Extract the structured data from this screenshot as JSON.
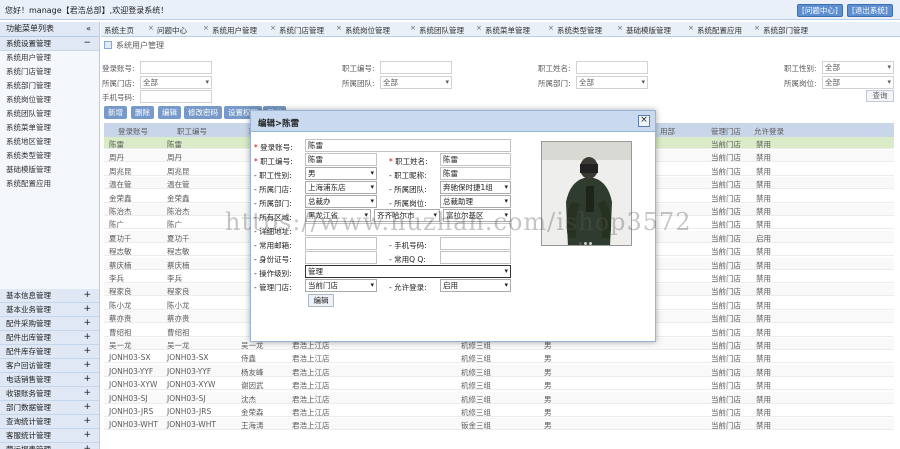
{
  "header": {
    "welcome": "您好！manage【君浩总部】,欢迎登录系统！",
    "help_button": "[问题中心]",
    "logout_button": "[退出系统]"
  },
  "sidebar": {
    "title": "功能菜单列表",
    "title_toggle": "«",
    "open_group": "系统设置管理",
    "open_group_toggle": "−",
    "items": [
      "系统用户管理",
      "系统门店管理",
      "系统部门管理",
      "系统岗位管理",
      "系统团队管理",
      "系统菜单管理",
      "系统地区管理",
      "系统类型管理",
      "基础模版管理",
      "系统配置应用"
    ],
    "groups": [
      "基本信息管理",
      "基本业务管理",
      "配件采购管理",
      "配件出库管理",
      "配件库存管理",
      "客户回访管理",
      "电话销售管理",
      "收银账务管理",
      "部门数据管理",
      "查询统计管理",
      "客服统计管理",
      "营运报表管理",
      "配件报价中心"
    ],
    "group_toggle": "+"
  },
  "tabs": [
    "系统主页",
    "问题中心",
    "系统用户管理",
    "系统门店管理",
    "系统岗位管理",
    "系统团队管理",
    "系统菜单管理",
    "系统类型管理",
    "基础模版管理",
    "系统配置应用",
    "系统部门管理"
  ],
  "tab_close": "×",
  "page_title": "系统用户管理",
  "search": {
    "login_label": "登录账号:",
    "staff_no_label": "职工编号:",
    "staff_name_label": "职工姓名:",
    "gender_label": "职工性别:",
    "gender_value": "全部",
    "store_label": "所属门店:",
    "store_value": "全部",
    "team_label": "所属团队:",
    "team_value": "全部",
    "dept_label": "所属部门:",
    "dept_value": "全部",
    "post_label": "所属岗位:",
    "post_value": "全部",
    "phone_label": "手机号码:",
    "search_button": "查询",
    "caret": "▾"
  },
  "toolbar": {
    "add": "新增",
    "delete": "删除",
    "edit": "编辑",
    "change_pwd": "修改密码",
    "set_perm": "设置权限",
    "export": "导出"
  },
  "table": {
    "headers": [
      "登录账号",
      "职工编号",
      "职",
      "所属门店",
      "",
      "",
      "",
      "用部",
      "管理门店",
      "允许登录"
    ],
    "rows": [
      {
        "login": "陈雷",
        "no": "陈雷",
        "name": "",
        "store": "",
        "team": "",
        "gender": "",
        "mgr": "当前门店",
        "allow": "禁用"
      },
      {
        "login": "周丹",
        "no": "周丹",
        "name": "",
        "store": "",
        "team": "",
        "gender": "",
        "mgr": "当前门店",
        "allow": "禁用"
      },
      {
        "login": "周兆昆",
        "no": "周兆昆",
        "name": "",
        "store": "",
        "team": "",
        "gender": "",
        "mgr": "当前门店",
        "allow": "禁用"
      },
      {
        "login": "温在管",
        "no": "温在管",
        "name": "",
        "store": "",
        "team": "",
        "gender": "",
        "mgr": "当前门店",
        "allow": "禁用"
      },
      {
        "login": "金荣鑫",
        "no": "金荣鑫",
        "name": "",
        "store": "",
        "team": "",
        "gender": "",
        "mgr": "当前门店",
        "allow": "禁用"
      },
      {
        "login": "陈治杰",
        "no": "陈治杰",
        "name": "",
        "store": "",
        "team": "",
        "gender": "",
        "mgr": "当前门店",
        "allow": "禁用"
      },
      {
        "login": "陈广",
        "no": "陈广",
        "name": "",
        "store": "",
        "team": "",
        "gender": "",
        "mgr": "当前门店",
        "allow": "禁用"
      },
      {
        "login": "夏功千",
        "no": "夏功千",
        "name": "",
        "store": "",
        "team": "",
        "gender": "",
        "mgr": "当前门店",
        "allow": "启用"
      },
      {
        "login": "程志敏",
        "no": "程志敏",
        "name": "",
        "store": "",
        "team": "",
        "gender": "",
        "mgr": "当前门店",
        "allow": "禁用"
      },
      {
        "login": "蔡庆楠",
        "no": "蔡庆楠",
        "name": "",
        "store": "",
        "team": "",
        "gender": "",
        "mgr": "当前门店",
        "allow": "禁用"
      },
      {
        "login": "李兵",
        "no": "李兵",
        "name": "",
        "store": "",
        "team": "",
        "gender": "",
        "mgr": "当前门店",
        "allow": "禁用"
      },
      {
        "login": "程家良",
        "no": "程家良",
        "name": "",
        "store": "",
        "team": "",
        "gender": "",
        "mgr": "当前门店",
        "allow": "禁用"
      },
      {
        "login": "陈小龙",
        "no": "陈小龙",
        "name": "",
        "store": "",
        "team": "",
        "gender": "",
        "mgr": "当前门店",
        "allow": "禁用"
      },
      {
        "login": "蔡亦贵",
        "no": "蔡亦贵",
        "name": "",
        "store": "",
        "team": "",
        "gender": "",
        "mgr": "当前门店",
        "allow": "禁用"
      },
      {
        "login": "曹绍祖",
        "no": "曹绍祖",
        "name": "",
        "store": "",
        "team": "",
        "gender": "",
        "mgr": "当前门店",
        "allow": "禁用"
      },
      {
        "login": "吴一龙",
        "no": "吴一龙",
        "name": "吴一龙",
        "store": "君浩上江店",
        "team": "机修三组",
        "gender": "男",
        "mgr": "当前门店",
        "allow": "禁用"
      },
      {
        "login": "JONH03-SX",
        "no": "JONH03-SX",
        "name": "侍鑫",
        "store": "君浩上江店",
        "team": "机修三组",
        "gender": "男",
        "mgr": "当前门店",
        "allow": "禁用"
      },
      {
        "login": "JONH03-YYF",
        "no": "JONH03-YYF",
        "name": "杨友峰",
        "store": "君浩上江店",
        "team": "机修三组",
        "gender": "男",
        "mgr": "当前门店",
        "allow": "禁用"
      },
      {
        "login": "JONH03-XYW",
        "no": "JONH03-XYW",
        "name": "谢因武",
        "store": "君浩上江店",
        "team": "机修三组",
        "gender": "男",
        "mgr": "当前门店",
        "allow": "禁用"
      },
      {
        "login": "JONH03-SJ",
        "no": "JONH03-SJ",
        "name": "沈杰",
        "store": "君浩上江店",
        "team": "机修三组",
        "gender": "男",
        "mgr": "当前门店",
        "allow": "禁用"
      },
      {
        "login": "JONH03-JRS",
        "no": "JONH03-JRS",
        "name": "金荣森",
        "store": "君浩上江店",
        "team": "机修三组",
        "gender": "男",
        "mgr": "当前门店",
        "allow": "禁用"
      },
      {
        "login": "JONH03-WHT",
        "no": "JONH03-WHT",
        "name": "王海涛",
        "store": "君浩上江店",
        "team": "钣金三组",
        "gender": "男",
        "mgr": "当前门店",
        "allow": "禁用"
      }
    ]
  },
  "modal": {
    "title": "编辑>陈雷",
    "close": "×",
    "req": "*",
    "dash": "-",
    "login_label": "登录账号:",
    "login_value": "陈雷",
    "staff_no_label": "职工编号:",
    "staff_no_value": "陈雷",
    "staff_name_label": "职工姓名:",
    "staff_name_value": "陈雷",
    "gender_label": "职工性别:",
    "gender_value": "男",
    "nickname_label": "职工昵称:",
    "nickname_value": "陈雷",
    "store_label": "所属门店:",
    "store_value": "上海浦东店",
    "team_label": "所属团队:",
    "team_value": "奔驰保时捷1组",
    "dept_label": "所属部门:",
    "dept_value": "总裁办",
    "post_label": "所属岗位:",
    "post_value": "总裁助理",
    "region_label": "所有区域:",
    "province": "黑龙江省",
    "city": "齐齐哈尔市",
    "district": "富拉尔基区",
    "detail_label": "详细地址:",
    "email_label": "常用邮箱:",
    "mobile_label": "手机号码:",
    "idcard_label": "身份证号:",
    "qq_label": "常用Q Q:",
    "level_label": "操作级别:",
    "level_value": "管理",
    "mgr_store_label": "管理门店:",
    "mgr_store_value": "当前门店",
    "allow_label": "允许登录:",
    "allow_value": "启用",
    "edit_button": "编辑",
    "caret": "▾"
  },
  "watermark": "https://www.huzhan.com/ishop3572"
}
